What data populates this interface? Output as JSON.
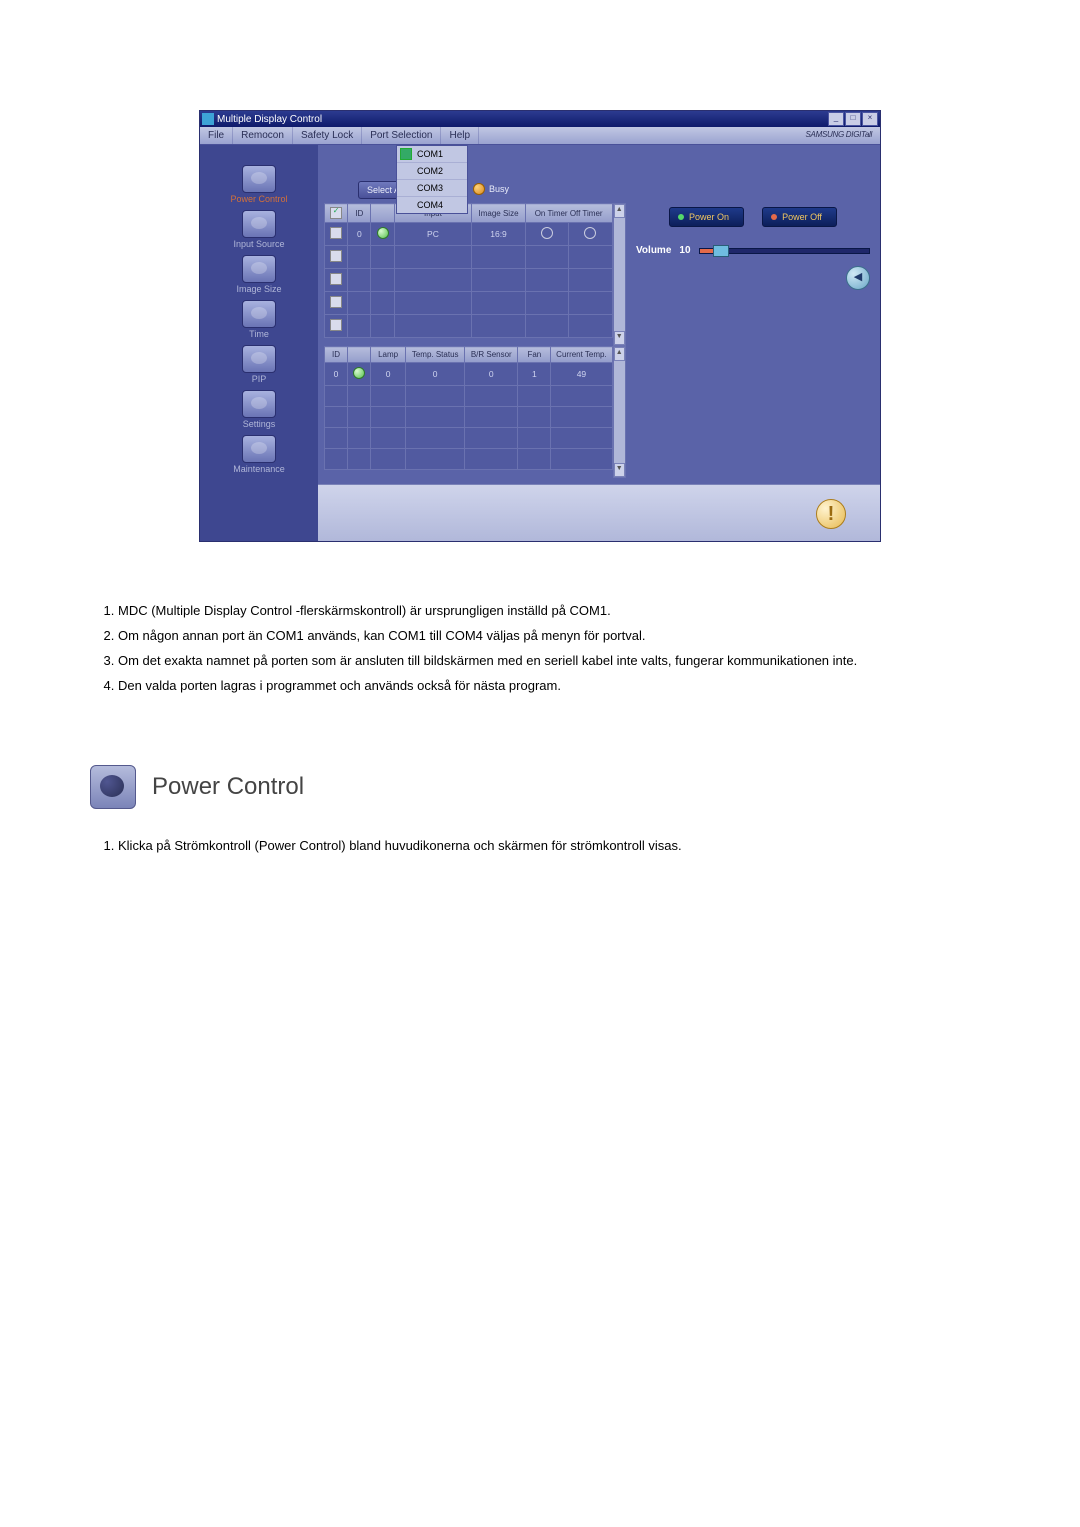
{
  "window": {
    "title": "Multiple Display Control",
    "menu": {
      "file": "File",
      "remocon": "Remocon",
      "safety_lock": "Safety Lock",
      "port_selection": "Port Selection",
      "help": "Help"
    },
    "brand": "SAMSUNG DIGITall",
    "port_options": {
      "com1": "COM1",
      "com2": "COM2",
      "com3": "COM3",
      "com4": "COM4"
    },
    "select_all": "Select All",
    "busy": "Busy",
    "sidebar": {
      "power_control": "Power Control",
      "input_source": "Input Source",
      "image_size": "Image Size",
      "time": "Time",
      "pip": "PIP",
      "settings": "Settings",
      "maintenance": "Maintenance"
    },
    "power_on": "Power On",
    "power_off": "Power Off",
    "volume_label": "Volume",
    "volume_value": "10",
    "table1": {
      "hdr_id": "ID",
      "hdr_input": "Input",
      "hdr_imgsize": "Image Size",
      "hdr_timer": "On Timer Off Timer",
      "row0_id": "0",
      "row0_input": "PC",
      "row0_imgsize": "16:9"
    },
    "table2": {
      "hdr_id": "ID",
      "hdr_lamp": "Lamp",
      "hdr_temp_status": "Temp. Status",
      "hdr_br_sensor": "B/R Sensor",
      "hdr_fan": "Fan",
      "hdr_cur_temp": "Current Temp.",
      "row0_id": "0",
      "row0_lamp": "0",
      "row0_temp": "0",
      "row0_br": "0",
      "row0_fan": "1",
      "row0_ct": "49"
    }
  },
  "doc": {
    "list1": {
      "i1": "MDC (Multiple Display Control -flerskärmskontroll) är ursprungligen inställd på COM1.",
      "i2": "Om någon annan port än COM1 används, kan COM1 till COM4 väljas på menyn för portval.",
      "i3": "Om det exakta namnet på porten som är ansluten till bildskärmen med en seriell kabel inte valts, fungerar kommunikationen inte.",
      "i4": "Den valda porten lagras i programmet och används också för nästa program."
    },
    "section_title": "Power Control",
    "list2": {
      "i1": "Klicka på Strömkontroll (Power Control) bland huvudikonerna och skärmen för strömkontroll visas."
    }
  }
}
